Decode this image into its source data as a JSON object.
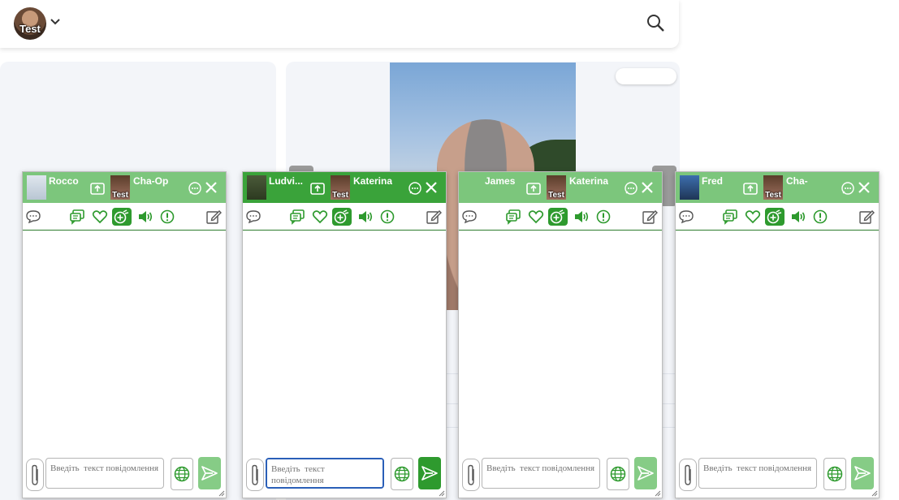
{
  "topbar": {
    "avatar_label": "Test"
  },
  "chats": [
    {
      "contact": "Rocco",
      "group": "Cha-Op",
      "group_badge": "Test",
      "placeholder": "Введіть  текст повідомлення"
    },
    {
      "contact": "Ludvi...",
      "group": "Katerina",
      "group_badge": "Test",
      "placeholder": "Введіть  текст повідомлення"
    },
    {
      "contact": "James",
      "group": "Katerina",
      "group_badge": "Test",
      "placeholder": "Введіть  текст повідомлення"
    },
    {
      "contact": "Fred",
      "group": "Cha-",
      "group_badge": "Test",
      "placeholder": "Введіть  текст повідомлення"
    }
  ],
  "colors": {
    "header": "#7cc67c",
    "header_dark": "#3aa33a",
    "accent": "#2e9a2e",
    "send": "#86cc86"
  }
}
